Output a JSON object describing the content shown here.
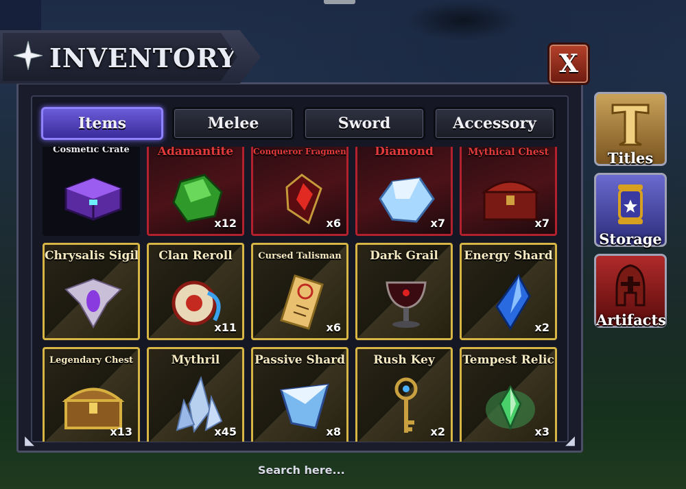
{
  "header": {
    "title": "INVENTORY",
    "close_label": "X"
  },
  "tabs": [
    {
      "label": "Items",
      "active": true
    },
    {
      "label": "Melee",
      "active": false
    },
    {
      "label": "Sword",
      "active": false
    },
    {
      "label": "Accessory",
      "active": false
    }
  ],
  "items": [
    {
      "name": "Cosmetic Crate",
      "qty": "",
      "rarity": "dark",
      "icon": "purple-crate-icon"
    },
    {
      "name": "Adamantite",
      "qty": "x12",
      "rarity": "red",
      "icon": "green-ore-icon"
    },
    {
      "name": "Conqueror Fragment",
      "qty": "x6",
      "rarity": "red",
      "icon": "red-shard-icon"
    },
    {
      "name": "Diamond",
      "qty": "x7",
      "rarity": "red",
      "icon": "diamond-icon"
    },
    {
      "name": "Mythical Chest",
      "qty": "x7",
      "rarity": "red",
      "icon": "red-chest-icon"
    },
    {
      "name": "Chrysalis Sigil",
      "qty": "",
      "rarity": "gold",
      "icon": "sigil-icon"
    },
    {
      "name": "Clan Reroll",
      "qty": "x11",
      "rarity": "gold",
      "icon": "scroll-icon"
    },
    {
      "name": "Cursed Talisman",
      "qty": "x6",
      "rarity": "gold",
      "icon": "talisman-icon"
    },
    {
      "name": "Dark Grail",
      "qty": "",
      "rarity": "gold",
      "icon": "grail-icon"
    },
    {
      "name": "Energy Shard",
      "qty": "x2",
      "rarity": "gold",
      "icon": "blue-crystal-icon"
    },
    {
      "name": "Legendary Chest",
      "qty": "x13",
      "rarity": "gold",
      "icon": "gold-chest-icon"
    },
    {
      "name": "Mythril",
      "qty": "x45",
      "rarity": "gold",
      "icon": "mythril-icon"
    },
    {
      "name": "Passive Shard",
      "qty": "x8",
      "rarity": "gold",
      "icon": "shard-icon"
    },
    {
      "name": "Rush Key",
      "qty": "x2",
      "rarity": "gold",
      "icon": "key-icon"
    },
    {
      "name": "Tempest Relic",
      "qty": "x3",
      "rarity": "gold",
      "icon": "relic-icon"
    }
  ],
  "side_buttons": [
    {
      "label": "Titles",
      "icon": "titles-icon"
    },
    {
      "label": "Storage",
      "icon": "storage-icon"
    },
    {
      "label": "Artifacts",
      "icon": "helmet-icon"
    }
  ],
  "search": {
    "placeholder": "Search here..."
  }
}
